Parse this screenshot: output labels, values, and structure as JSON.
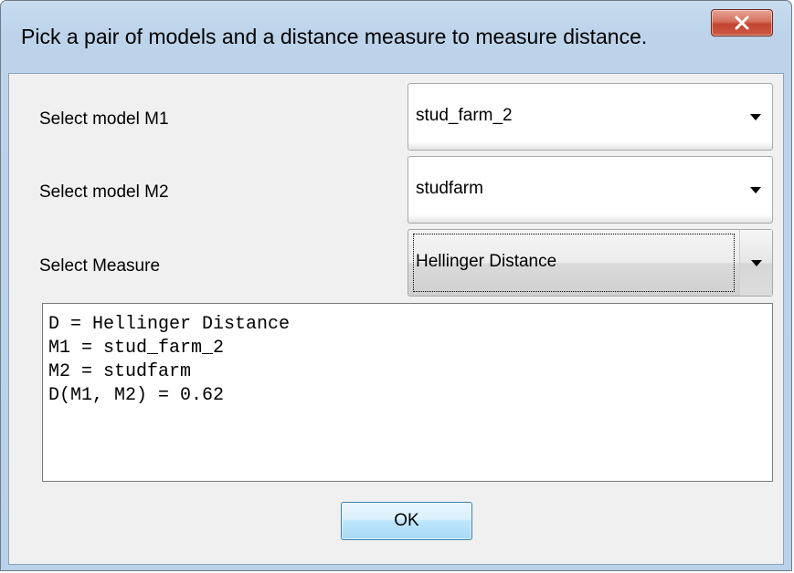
{
  "window": {
    "title": "Pick a pair of models and a distance measure to measure distance.",
    "close_icon": "close-x-icon"
  },
  "form": {
    "rows": [
      {
        "label": "Select model M1",
        "value": "stud_farm_2"
      },
      {
        "label": "Select model M2",
        "value": "studfarm"
      },
      {
        "label": "Select Measure",
        "value": "Hellinger Distance"
      }
    ]
  },
  "output": {
    "lines": [
      "D = Hellinger Distance",
      "M1 = stud_farm_2",
      "M2 = studfarm",
      "D(M1, M2) = 0.62"
    ]
  },
  "buttons": {
    "ok_label": "OK"
  },
  "colors": {
    "title_bar": "#bcd3ea",
    "client_background": "#f0f0f0",
    "close_button": "#c2432f",
    "ok_button": "#bee6fd"
  }
}
